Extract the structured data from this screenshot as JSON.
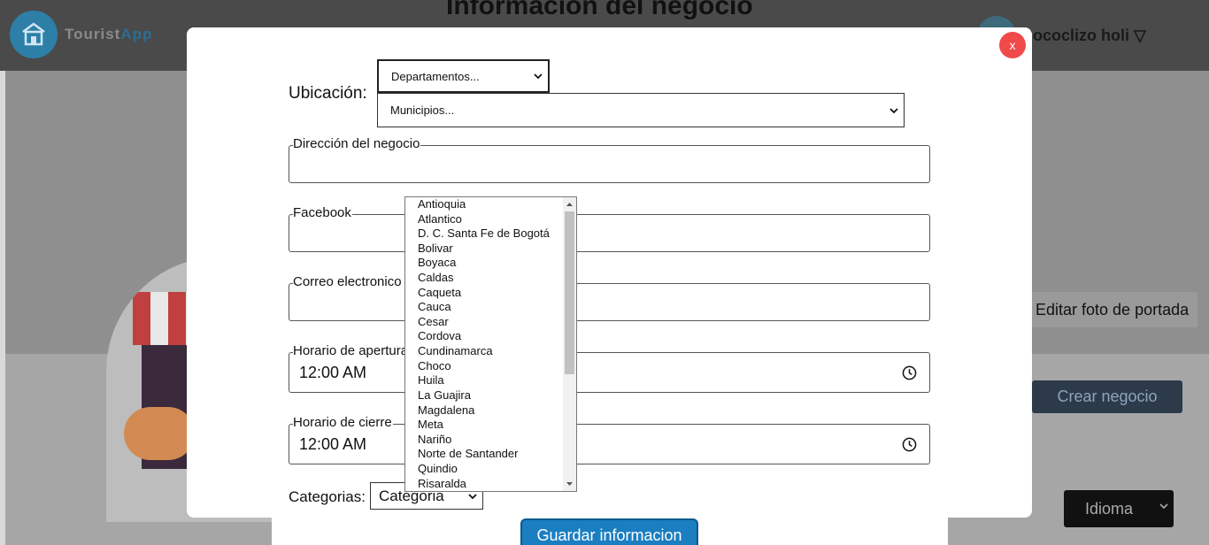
{
  "background": {
    "app_name_part1": "Tourist",
    "app_name_part2": "App",
    "page_title": "Información del negocio",
    "user_name": "Cococlizo holi ▽",
    "edit_cover_label": "Editar foto de portada",
    "create_business_label": "Crear negocio",
    "language_label": "Idioma"
  },
  "modal": {
    "close_label": "x",
    "location_label": "Ubicación:",
    "departments_select": "Departamentos...",
    "municipalities_select": "Municipios...",
    "address_label": "Dirección del negocio",
    "facebook_label": "Facebook",
    "email_label": "Correo electronico d",
    "opening_label": "Horario de apertura",
    "opening_value": "12:00  AM",
    "closing_label": "Horario de cierre",
    "closing_value": "12:00  AM",
    "categories_label": "Categorias:",
    "category_select": "Categoria",
    "save_button": "Guardar informacion"
  },
  "dropdown": {
    "options": [
      "Antioquia",
      "Atlantico",
      "D. C. Santa Fe de Bogotá",
      "Bolivar",
      "Boyaca",
      "Caldas",
      "Caqueta",
      "Cauca",
      "Cesar",
      "Cordova",
      "Cundinamarca",
      "Choco",
      "Huila",
      "La Guajira",
      "Magdalena",
      "Meta",
      "Nariño",
      "Norte de Santander",
      "Quindio",
      "Risaralda"
    ]
  },
  "colors": {
    "close_button": "#f04a4a",
    "save_button": "#1a7ec1",
    "overlay_header": "#4a4a4a"
  }
}
